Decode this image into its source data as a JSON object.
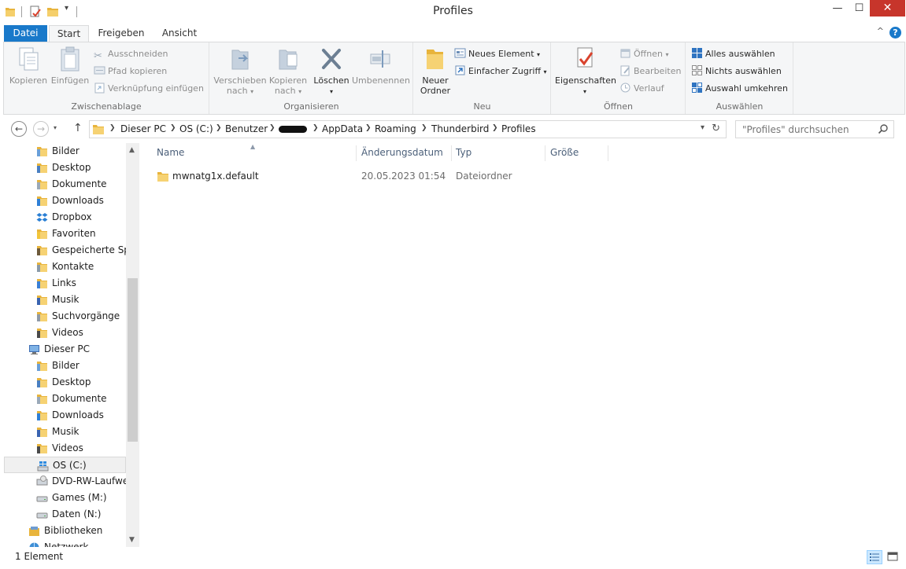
{
  "window": {
    "title": "Profiles",
    "minimize_glyph": "—",
    "maximize_glyph": "☐",
    "close_glyph": "✕"
  },
  "ribbon_tabs": {
    "file": "Datei",
    "start": "Start",
    "share": "Freigeben",
    "view": "Ansicht",
    "help_glyph": "?",
    "collapse_glyph": "^"
  },
  "ribbon": {
    "clipboard": {
      "label": "Zwischenablage",
      "copy": "Kopieren",
      "paste": "Einfügen",
      "cut": "Ausschneiden",
      "copy_path": "Pfad kopieren",
      "paste_shortcut": "Verknüpfung einfügen"
    },
    "organize": {
      "label": "Organisieren",
      "move_to_1": "Verschieben",
      "move_to_2": "nach",
      "copy_to_1": "Kopieren",
      "copy_to_2": "nach",
      "delete": "Löschen",
      "rename": "Umbenennen"
    },
    "new": {
      "label": "Neu",
      "new_folder_1": "Neuer",
      "new_folder_2": "Ordner",
      "new_item": "Neues Element",
      "easy_access": "Einfacher Zugriff"
    },
    "open": {
      "label": "Öffnen",
      "properties": "Eigenschaften",
      "open": "Öffnen",
      "edit": "Bearbeiten",
      "history": "Verlauf"
    },
    "select": {
      "label": "Auswählen",
      "select_all": "Alles auswählen",
      "select_none": "Nichts auswählen",
      "invert": "Auswahl umkehren"
    }
  },
  "address": {
    "crumbs": [
      "Dieser PC",
      "OS (C:)",
      "Benutzer",
      "AppData",
      "Roaming",
      "Thunderbird",
      "Profiles"
    ],
    "search_placeholder": "\"Profiles\" durchsuchen"
  },
  "nav_tree": [
    {
      "label": "Bilder",
      "icon": "pictures-folder-icon"
    },
    {
      "label": "Desktop",
      "icon": "desktop-folder-icon"
    },
    {
      "label": "Dokumente",
      "icon": "documents-folder-icon"
    },
    {
      "label": "Downloads",
      "icon": "downloads-folder-icon"
    },
    {
      "label": "Dropbox",
      "icon": "dropbox-icon"
    },
    {
      "label": "Favoriten",
      "icon": "favorites-folder-icon"
    },
    {
      "label": "Gespeicherte Spiel",
      "icon": "saved-games-folder-icon"
    },
    {
      "label": "Kontakte",
      "icon": "contacts-folder-icon"
    },
    {
      "label": "Links",
      "icon": "links-folder-icon"
    },
    {
      "label": "Musik",
      "icon": "music-folder-icon"
    },
    {
      "label": "Suchvorgänge",
      "icon": "searches-folder-icon"
    },
    {
      "label": "Videos",
      "icon": "videos-folder-icon"
    },
    {
      "label": "Dieser PC",
      "icon": "computer-icon"
    },
    {
      "label": "Bilder",
      "icon": "pictures-folder-icon"
    },
    {
      "label": "Desktop",
      "icon": "desktop-folder-icon"
    },
    {
      "label": "Dokumente",
      "icon": "documents-folder-icon"
    },
    {
      "label": "Downloads",
      "icon": "downloads-folder-icon"
    },
    {
      "label": "Musik",
      "icon": "music-folder-icon"
    },
    {
      "label": "Videos",
      "icon": "videos-folder-icon"
    },
    {
      "label": "OS (C:)",
      "icon": "windows-drive-icon"
    },
    {
      "label": "DVD-RW-Laufwerk",
      "icon": "dvd-drive-icon"
    },
    {
      "label": "Games (M:)",
      "icon": "drive-icon"
    },
    {
      "label": "Daten (N:)",
      "icon": "drive-icon"
    },
    {
      "label": "Bibliotheken",
      "icon": "libraries-icon"
    },
    {
      "label": "Netzwerk",
      "icon": "network-icon"
    }
  ],
  "columns": {
    "name": "Name",
    "date": "Änderungsdatum",
    "type": "Typ",
    "size": "Größe"
  },
  "files": [
    {
      "name": "mwnatg1x.default",
      "date": "20.05.2023 01:54",
      "type": "Dateiordner",
      "size": ""
    }
  ],
  "status": {
    "count": "1 Element"
  },
  "colors": {
    "accent": "#1979ca",
    "folder": "#e8b43c",
    "close": "#c7352b"
  }
}
